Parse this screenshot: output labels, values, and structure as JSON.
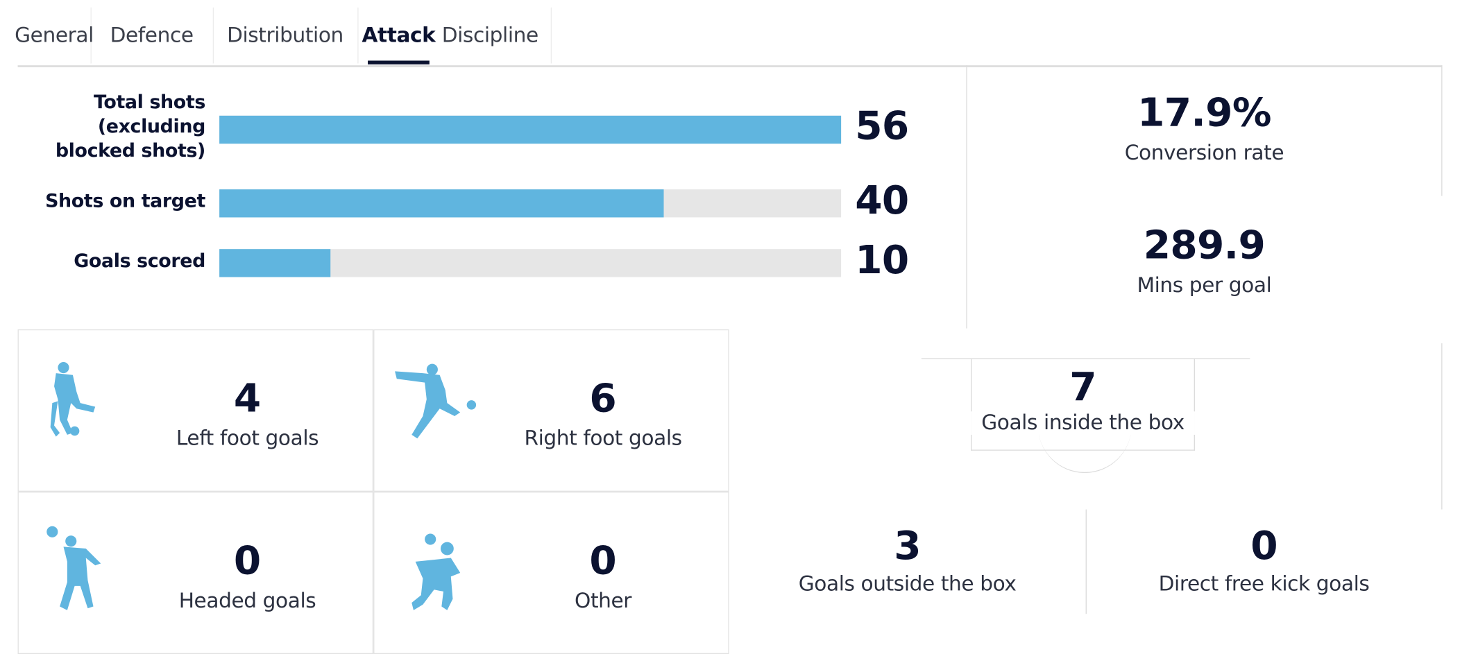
{
  "tabs": [
    {
      "label": "General"
    },
    {
      "label": "Defence"
    },
    {
      "label": "Distribution"
    },
    {
      "label": "Attack",
      "active": true
    },
    {
      "label": "Discipline"
    }
  ],
  "bars": {
    "max": 56,
    "items": [
      {
        "label_lines": [
          "Total shots",
          "(excluding",
          "blocked shots)"
        ],
        "value": 56
      },
      {
        "label_lines": [
          "Shots on target"
        ],
        "value": 40
      },
      {
        "label_lines": [
          "Goals scored"
        ],
        "value": 10
      }
    ]
  },
  "summary": {
    "conversion_rate": {
      "value": "17.9%",
      "label": "Conversion rate"
    },
    "mins_per_goal": {
      "value": "289.9",
      "label": "Mins per goal"
    }
  },
  "goal_types": [
    {
      "value": "4",
      "label": "Left foot goals",
      "icon": "left-foot-player-icon"
    },
    {
      "value": "6",
      "label": "Right foot goals",
      "icon": "right-foot-player-icon"
    },
    {
      "value": "0",
      "label": "Headed goals",
      "icon": "header-player-icon"
    },
    {
      "value": "0",
      "label": "Other",
      "icon": "other-goal-player-icon"
    }
  ],
  "goal_locations": {
    "inside_box": {
      "value": "7",
      "label": "Goals inside the box"
    },
    "outside_box": {
      "value": "3",
      "label": "Goals outside the box"
    },
    "free_kick": {
      "value": "0",
      "label": "Direct free kick goals"
    }
  },
  "colors": {
    "accent": "#60b5df",
    "text": "#0b1230",
    "track": "#e6e6e6"
  }
}
